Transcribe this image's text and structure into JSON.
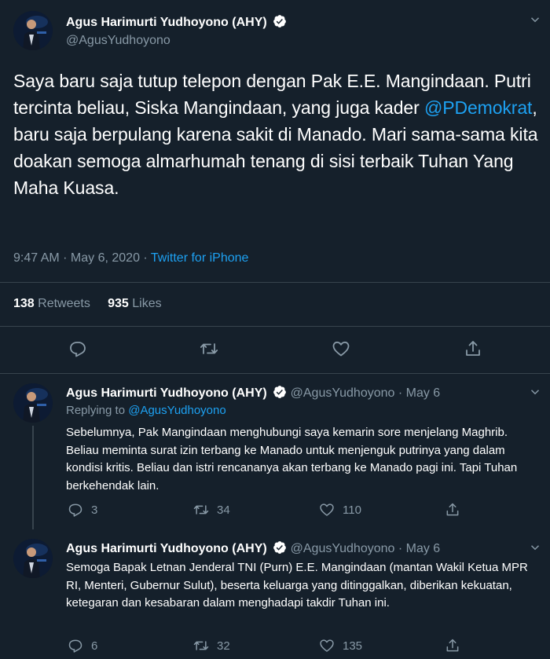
{
  "main_tweet": {
    "name": "Agus Harimurti Yudhoyono (AHY)",
    "handle": "@AgusYudhoyono",
    "text_before": "Saya baru saja tutup telepon dengan Pak E.E. Mangindaan. Putri tercinta beliau, Siska Mangindaan, yang juga kader ",
    "mention": "@PDemokrat",
    "text_after": ", baru saja berpulang karena sakit di Manado. Mari sama-sama kita doakan semoga almarhumah tenang di sisi terbaik Tuhan Yang Maha Kuasa.",
    "timestamp": "9:47 AM · May 6, 2020 · ",
    "source": "Twitter for iPhone",
    "retweets": "138",
    "retweets_label": "Retweets",
    "likes": "935",
    "likes_label": "Likes"
  },
  "replies": [
    {
      "name": "Agus Harimurti Yudhoyono (AHY)",
      "handle_date": "@AgusYudhoyono · May 6",
      "replying_label": "Replying to ",
      "replying_to": "@AgusYudhoyono",
      "text": "Sebelumnya, Pak Mangindaan menghubungi saya kemarin sore menjelang Maghrib. Beliau meminta surat izin terbang ke Manado untuk menjenguk putrinya yang dalam kondisi kritis. Beliau dan istri rencananya akan terbang ke Manado pagi ini. Tapi Tuhan berkehendak lain.",
      "replies": "3",
      "retweets": "34",
      "likes": "110"
    },
    {
      "name": "Agus Harimurti Yudhoyono (AHY)",
      "handle_date": "@AgusYudhoyono · May 6",
      "text": "Semoga Bapak Letnan Jenderal TNI (Purn) E.E. Mangindaan (mantan Wakil Ketua MPR RI, Menteri, Gubernur Sulut), beserta keluarga yang ditinggalkan, diberikan kekuatan, ketegaran dan kesabaran dalam menghadapi takdir Tuhan ini.",
      "replies": "6",
      "retweets": "32",
      "likes": "135"
    }
  ],
  "colors": {
    "background": "#15202b",
    "text": "#ffffff",
    "muted": "#8899a6",
    "accent": "#1da1f2",
    "divider": "#38444d"
  },
  "icons": [
    "verified-badge-icon",
    "chevron-down-icon",
    "reply-icon",
    "retweet-icon",
    "like-icon",
    "share-icon"
  ]
}
